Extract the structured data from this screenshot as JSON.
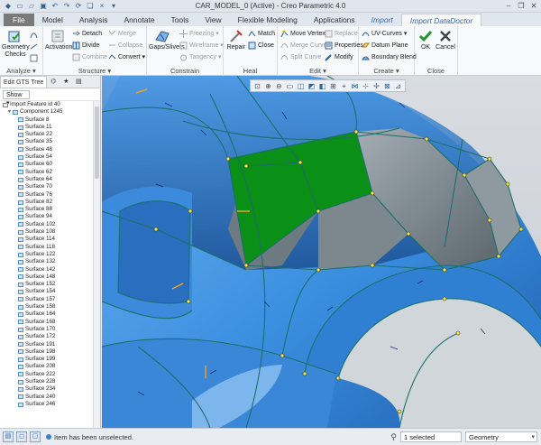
{
  "window": {
    "title": "CAR_MODEL_0 (Active) - Creo Parametric 4.0",
    "controls": [
      "–",
      "❐",
      "✕"
    ]
  },
  "tabs": [
    {
      "label": "File"
    },
    {
      "label": "Model"
    },
    {
      "label": "Analysis"
    },
    {
      "label": "Annotate"
    },
    {
      "label": "Tools"
    },
    {
      "label": "View"
    },
    {
      "label": "Flexible Modeling"
    },
    {
      "label": "Applications"
    },
    {
      "label": "Import"
    },
    {
      "label": "Import DataDoctor"
    }
  ],
  "ribbon": {
    "analyze": {
      "label": "Analyze",
      "geometry_checks": "Geometry Checks"
    },
    "structure": {
      "label": "Structure",
      "activation": "Activation",
      "detach": "Detach",
      "divide": "Divide",
      "combine": "Combine",
      "merge": "Merge",
      "collapse": "Collapse",
      "convert": "Convert"
    },
    "constrain": {
      "label": "Constrain",
      "gaps_slivers": "Gaps/Slivers",
      "freezing": "Freezing",
      "wireframe": "Wireframe",
      "tangency": "Tangency"
    },
    "heal": {
      "label": "Heal",
      "repair": "Repair",
      "match": "Match",
      "close": "Close"
    },
    "edit": {
      "label": "Edit",
      "move_vertex": "Move Vertex",
      "merge_curves": "Merge Curves",
      "split_curve": "Split Curve",
      "replace": "Replace",
      "properties": "Properties",
      "modify": "Modify"
    },
    "create": {
      "label": "Create",
      "uv_curves": "UV-Curves",
      "datum_plane": "Datum Plane",
      "boundary_blend": "Boundary Blend"
    },
    "close": {
      "label": "Close",
      "ok": "OK",
      "cancel": "Cancel"
    }
  },
  "tree": {
    "tab_label": "Edit GTS Tree",
    "show_label": "Show",
    "root": "Import Feature id 40",
    "component": "Component 1245",
    "items": [
      "Surface 8",
      "Surface 11",
      "Surface 22",
      "Surface 35",
      "Surface 48",
      "Surface 54",
      "Surface 60",
      "Surface 62",
      "Surface 64",
      "Surface 70",
      "Surface 76",
      "Surface 82",
      "Surface 88",
      "Surface 94",
      "Surface 102",
      "Surface 108",
      "Surface 114",
      "Surface 118",
      "Surface 122",
      "Surface 132",
      "Surface 142",
      "Surface 148",
      "Surface 152",
      "Surface 154",
      "Surface 157",
      "Surface 158",
      "Surface 164",
      "Surface 168",
      "Surface 170",
      "Surface 172",
      "Surface 191",
      "Surface 198",
      "Surface 199",
      "Surface 208",
      "Surface 222",
      "Surface 228",
      "Surface 234",
      "Surface 240",
      "Surface 246"
    ]
  },
  "status": {
    "message": "Item has been unselected.",
    "selection": "1 selected",
    "filter": "Geometry"
  },
  "colors": {
    "surface_blue": "#3b8fe0",
    "surface_gray": "#7e8b93",
    "selected_green": "#0a8f17",
    "edge_teal": "#1d6f6a"
  }
}
